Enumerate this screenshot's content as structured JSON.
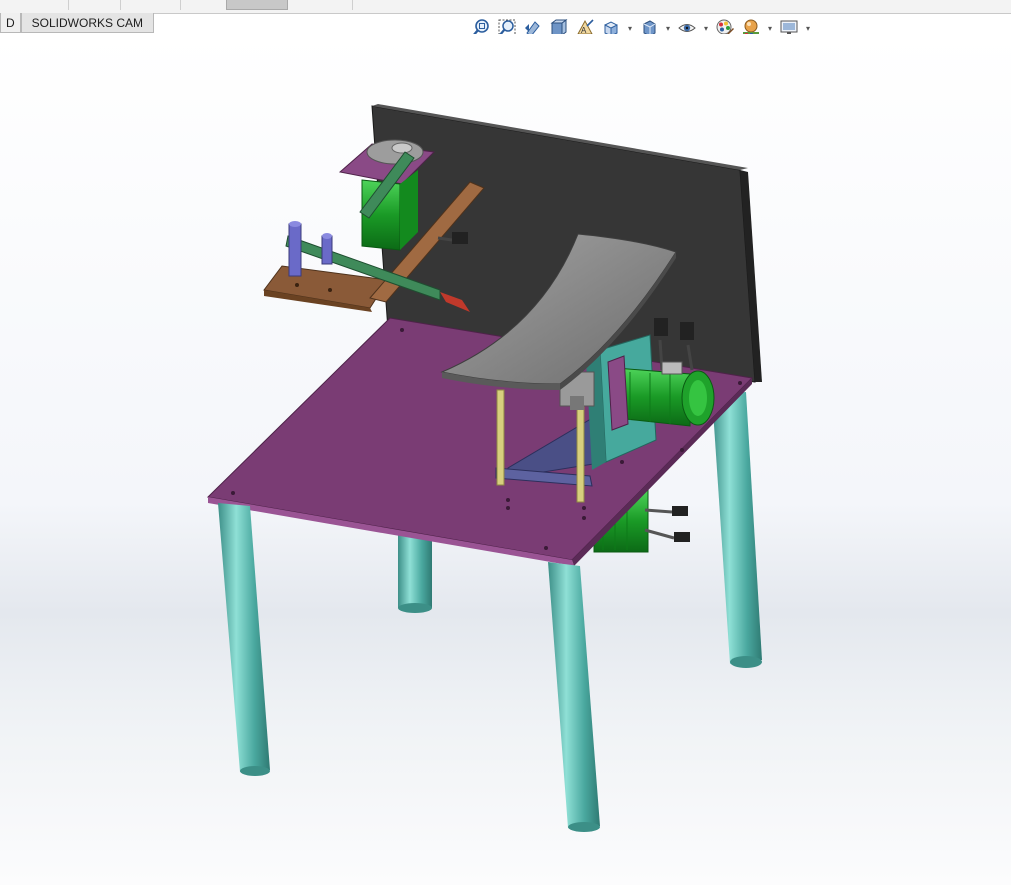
{
  "tabs": [
    {
      "label": "D",
      "partial": true
    },
    {
      "label": "SOLIDWORKS CAM",
      "selected": true
    }
  ],
  "heads_up_toolbar": [
    {
      "icon": "zoom-to-fit-icon",
      "dropdown": false
    },
    {
      "icon": "zoom-to-area-icon",
      "dropdown": false
    },
    {
      "icon": "previous-view-icon",
      "dropdown": false
    },
    {
      "icon": "section-view-icon",
      "dropdown": false
    },
    {
      "icon": "dynamic-annotation-views-icon",
      "dropdown": false
    },
    {
      "icon": "view-orientation-icon",
      "dropdown": true
    },
    {
      "icon": "display-style-icon",
      "dropdown": true
    },
    {
      "icon": "hide-show-items-icon",
      "dropdown": true
    },
    {
      "icon": "edit-appearance-icon",
      "dropdown": false
    },
    {
      "icon": "apply-scene-icon",
      "dropdown": true
    },
    {
      "icon": "view-settings-icon",
      "dropdown": true
    }
  ],
  "model_colors": {
    "table_top": "#7a3c74",
    "back_panel": "#3a3a3a",
    "legs": "#5fb8b0",
    "curved_plate": "#8d8d8d",
    "wood_shelf": "#8a5a38",
    "arm_links": "#3f8a5a",
    "motors": "#1e9e2a",
    "support_plate": "#4a4f86",
    "bracket": "#46a99d",
    "posts": "#d7cf7e",
    "motor_mount": "#8a4a86"
  }
}
